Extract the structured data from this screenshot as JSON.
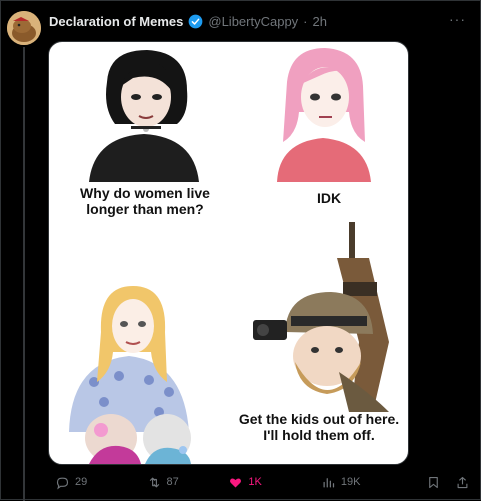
{
  "tweet": {
    "author_name": "Declaration of Memes",
    "handle": "@LibertyCappy",
    "separator": "·",
    "time": "2h",
    "more_label": "···"
  },
  "meme": {
    "top_left_caption": "Why do women live longer than men?",
    "top_right_caption": "IDK",
    "bottom_right_caption": "Get the kids out of here. I'll hold them off."
  },
  "actions": {
    "replies": "29",
    "reposts": "87",
    "likes": "1K",
    "views": "19K"
  },
  "colors": {
    "like_active": "#f91880",
    "verified": "#1d9bf0",
    "muted": "#71767b"
  }
}
